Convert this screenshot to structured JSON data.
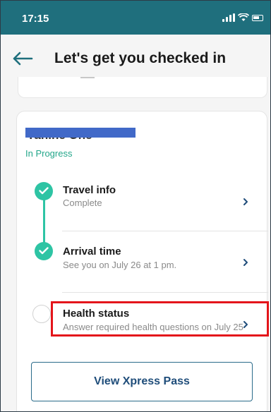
{
  "status_bar": {
    "time": "17:15"
  },
  "header": {
    "title": "Let's get you checked in",
    "back_icon": "arrow-left-icon"
  },
  "card": {
    "passenger_name": "Yahine One",
    "status": "In Progress",
    "status_color": "#23a68a",
    "steps": [
      {
        "title": "Travel info",
        "subtitle": "Complete",
        "state": "complete",
        "icon": "check-icon"
      },
      {
        "title": "Arrival time",
        "subtitle": "See you on July 26 at 1 pm.",
        "state": "complete",
        "icon": "check-icon"
      },
      {
        "title": "Health status",
        "subtitle": "Answer required health questions on July 25",
        "state": "pending",
        "icon": "empty-circle-icon"
      }
    ]
  },
  "actions": {
    "view_pass_label": "View Xpress Pass"
  },
  "colors": {
    "status_bar": "#1f6f7d",
    "accent": "#2ec4a4",
    "highlight": "#e4151b",
    "button_text": "#1f4d7a"
  }
}
